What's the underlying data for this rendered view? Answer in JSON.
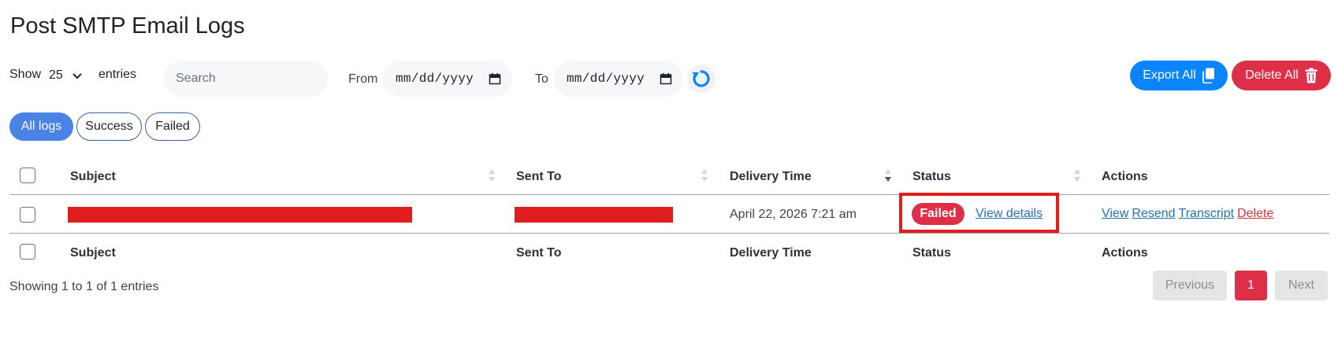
{
  "page": {
    "title": "Post SMTP Email Logs"
  },
  "toolbar": {
    "show_label": "Show",
    "entries_value": "25",
    "entries_label": "entries",
    "search_placeholder": "Search",
    "from_label": "From",
    "from_placeholder": "mm/dd/yyyy",
    "to_label": "To",
    "to_placeholder": "mm/dd/yyyy",
    "export_label": "Export All",
    "delete_label": "Delete All"
  },
  "filters": [
    {
      "label": "All logs",
      "active": true
    },
    {
      "label": "Success",
      "active": false
    },
    {
      "label": "Failed",
      "active": false
    }
  ],
  "table": {
    "columns": [
      "Subject",
      "Sent To",
      "Delivery Time",
      "Status",
      "Actions"
    ],
    "rows": [
      {
        "subject": "",
        "sent_to": "",
        "delivery_time": "April 22, 2026 7:21 am",
        "status": "Failed",
        "status_link": "View details",
        "actions": [
          "View",
          "Resend",
          "Transcript",
          "Delete"
        ]
      }
    ]
  },
  "footer": {
    "info": "Showing 1 to 1 of 1 entries",
    "prev_label": "Previous",
    "page_number": "1",
    "next_label": "Next"
  },
  "colors": {
    "primary_blue": "#0a84ff",
    "danger_red": "#de2f49",
    "active_pill": "#4a83e6",
    "link": "#2271b1",
    "redaction": "#e01e1e"
  }
}
